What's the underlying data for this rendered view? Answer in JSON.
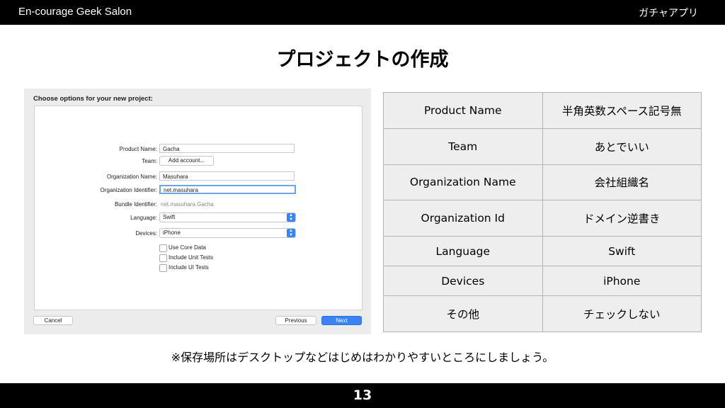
{
  "header": {
    "left": "En-courage Geek Salon",
    "right": "ガチャアプリ"
  },
  "title": "プロジェクトの作成",
  "dialog": {
    "heading": "Choose options for your new project:",
    "fields": {
      "product_name": {
        "label": "Product Name:",
        "value": "Gacha"
      },
      "team": {
        "label": "Team:",
        "button": "Add account..."
      },
      "organization_name": {
        "label": "Organization Name:",
        "value": "Masuhara"
      },
      "organization_identifier": {
        "label": "Organization Identifier:",
        "value": "net.masuhara"
      },
      "bundle_identifier": {
        "label": "Bundle Identifier:",
        "value": "net.masuhara.Gacha"
      },
      "language": {
        "label": "Language:",
        "value": "Swift"
      },
      "devices": {
        "label": "Devices:",
        "value": "iPhone"
      }
    },
    "checkboxes": [
      "Use Core Data",
      "Include Unit Tests",
      "Include UI Tests"
    ],
    "buttons": {
      "cancel": "Cancel",
      "previous": "Previous",
      "next": "Next"
    }
  },
  "table": {
    "rows": [
      [
        "Product Name",
        "半角英数スペース記号無"
      ],
      [
        "Team",
        "あとでいい"
      ],
      [
        "Organization Name",
        "会社組織名"
      ],
      [
        "Organization Id",
        "ドメイン逆書き"
      ],
      [
        "Language",
        "Swift"
      ],
      [
        "Devices",
        "iPhone"
      ],
      [
        "その他",
        "チェックしない"
      ]
    ]
  },
  "note": "※保存場所はデスクトップなどはじめはわかりやすいところにしましょう。",
  "page_number": "13",
  "colors": {
    "bar": "#000000",
    "accent": "#3a82f7",
    "table_cell": "#eeeeee"
  }
}
